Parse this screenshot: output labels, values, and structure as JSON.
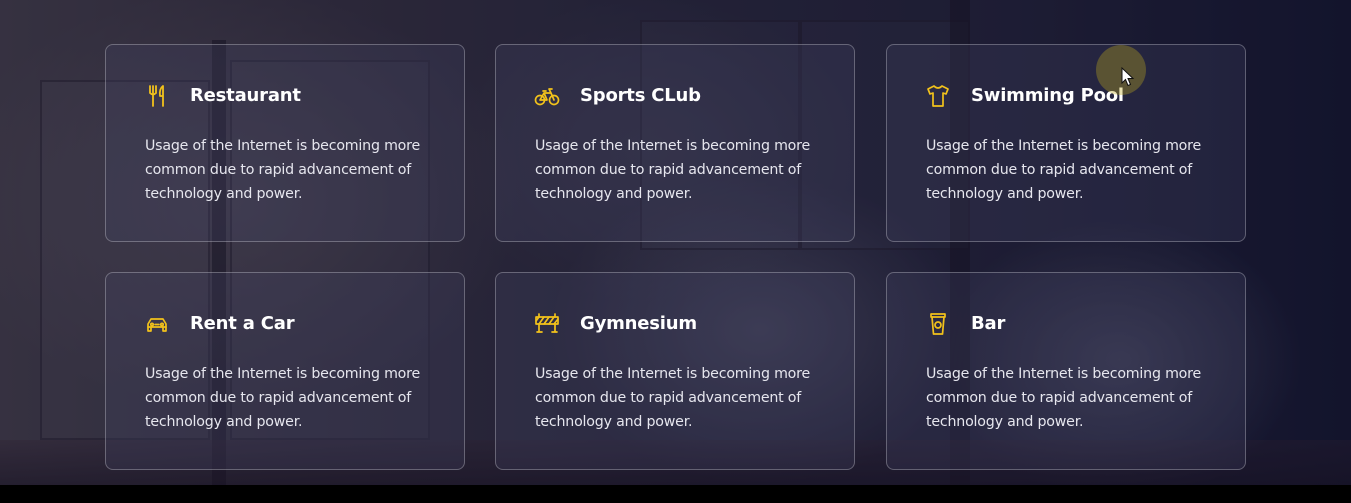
{
  "accent_color": "#f2c21b",
  "services": [
    {
      "icon": "utensils-icon",
      "title": "Restaurant",
      "description": "Usage of the Internet is becoming more common due to rapid advancement of technology and power."
    },
    {
      "icon": "bicycle-icon",
      "title": "Sports CLub",
      "description": "Usage of the Internet is becoming more common due to rapid advancement of technology and power."
    },
    {
      "icon": "tshirt-icon",
      "title": "Swimming Pool",
      "description": "Usage of the Internet is becoming more common due to rapid advancement of technology and power."
    },
    {
      "icon": "car-icon",
      "title": "Rent a Car",
      "description": "Usage of the Internet is becoming more common due to rapid advancement of technology and power."
    },
    {
      "icon": "barrier-icon",
      "title": "Gymnesium",
      "description": "Usage of the Internet is becoming more common due to rapid advancement of technology and power."
    },
    {
      "icon": "cup-icon",
      "title": "Bar",
      "description": "Usage of the Internet is becoming more common due to rapid advancement of technology and power."
    }
  ]
}
